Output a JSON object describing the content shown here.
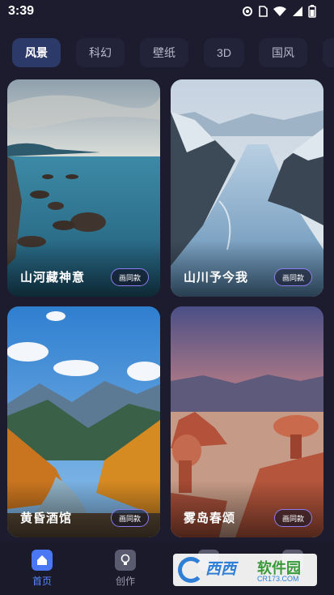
{
  "status_bar": {
    "time": "3:39"
  },
  "tabs": [
    {
      "label": "风景",
      "active": true
    },
    {
      "label": "科幻",
      "active": false
    },
    {
      "label": "壁纸",
      "active": false
    },
    {
      "label": "3D",
      "active": false
    },
    {
      "label": "国风",
      "active": false
    }
  ],
  "cards": [
    {
      "title": "山河藏神意",
      "badge": "画同款",
      "scene": "rocky-coast"
    },
    {
      "title": "山川予今我",
      "badge": "画同款",
      "scene": "fjord"
    },
    {
      "title": "黄昏酒馆",
      "badge": "画同款",
      "scene": "autumn-valley"
    },
    {
      "title": "雾岛春颂",
      "badge": "画同款",
      "scene": "desert-rocks"
    }
  ],
  "bottom_nav": [
    {
      "label": "首页",
      "icon": "home-icon",
      "active": true
    },
    {
      "label": "创作",
      "icon": "bulb-icon",
      "active": false
    },
    {
      "label": "",
      "icon": "chat-icon",
      "active": false
    },
    {
      "label": "",
      "icon": "profile-icon",
      "active": false
    }
  ],
  "watermark": {
    "brand": "西西",
    "text": "软件园",
    "domain": "CR173.COM"
  },
  "colors": {
    "accent": "#4a78f5",
    "badge_border": "#8c7cf0",
    "background": "#1c1c2e"
  }
}
